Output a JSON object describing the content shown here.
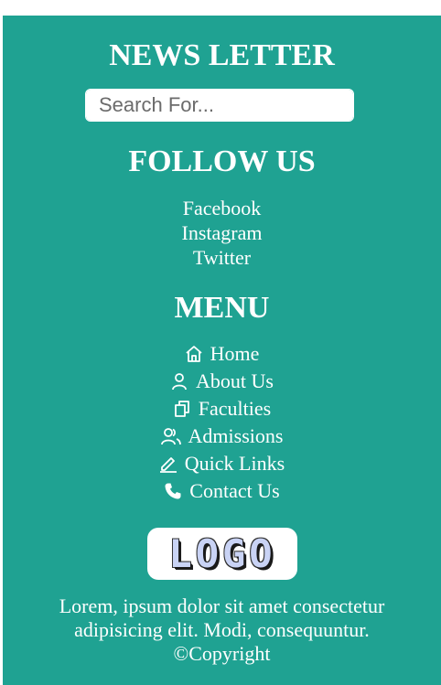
{
  "newsletter": {
    "title": "NEWS LETTER",
    "search_placeholder": "Search For...",
    "send_icon": "mail-send-icon"
  },
  "follow": {
    "title": "FOLLOW US",
    "links": [
      "Facebook",
      "Instagram",
      "Twitter"
    ]
  },
  "menu": {
    "title": "MENU",
    "items": [
      {
        "label": "Home",
        "icon": "home-icon"
      },
      {
        "label": "About Us",
        "icon": "user-icon"
      },
      {
        "label": "Faculties",
        "icon": "copy-icon"
      },
      {
        "label": "Admissions",
        "icon": "users-icon"
      },
      {
        "label": "Quick Links",
        "icon": "pencil-icon"
      },
      {
        "label": "Contact Us",
        "icon": "phone-icon"
      }
    ]
  },
  "logo": {
    "text": "LOGO"
  },
  "footer_text": {
    "line1": "Lorem, ipsum dolor sit amet consectetur",
    "line2": "adipisicing elit. Modi, consequuntur.",
    "line3": "©Copyright"
  },
  "colors": {
    "background": "#1fa292",
    "text": "#ffffff"
  }
}
